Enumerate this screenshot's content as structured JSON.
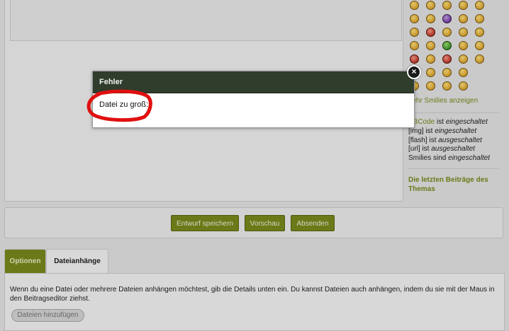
{
  "dialog": {
    "title": "Fehler",
    "message": "Datei zu groß:",
    "close_symbol": "×",
    "header_color": "#303c2c",
    "highlight_color": "#e01010"
  },
  "sidebar": {
    "more_smilies": "Mehr Smilies anzeigen",
    "options": [
      {
        "label": "BBCode",
        "text": " ist ",
        "state": "eingeschaltet"
      },
      {
        "label": "[img]",
        "text": " ist ",
        "state": "eingeschaltet"
      },
      {
        "label": "[flash]",
        "text": " ist ",
        "state": "ausgeschaltet"
      },
      {
        "label": "[url]",
        "text": " ist ",
        "state": "ausgeschaltet"
      },
      {
        "label": "Smilies",
        "text": " sind ",
        "state": "eingeschaltet"
      }
    ],
    "last_posts": "Die letzten Beiträge des Themas"
  },
  "buttons": {
    "save_draft": "Entwurf speichern",
    "preview": "Vorschau",
    "submit": "Absenden"
  },
  "tabs": [
    {
      "label": "Optionen",
      "active": true
    },
    {
      "label": "Dateianhänge",
      "active": false
    }
  ],
  "attachments": {
    "description": "Wenn du eine Datei oder mehrere Dateien anhängen möchtest, gib die Details unten ein. Du kannst Dateien auch anhängen, indem du sie mit der Maus in den Beitragseditor ziehst.",
    "add_files_button": "Dateien hinzufügen"
  },
  "colors": {
    "accent": "#7c8a1c",
    "page_bg": "#e6e6e6"
  }
}
